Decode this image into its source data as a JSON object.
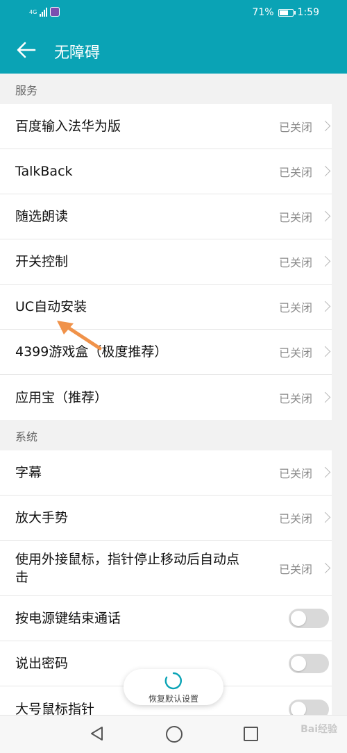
{
  "status_bar": {
    "network": "4G",
    "battery_percent": 71,
    "battery_text": "71%",
    "time": "1:59"
  },
  "app_bar": {
    "title": "无障碍",
    "back_icon": "arrow-left-icon"
  },
  "sections": [
    {
      "header": "服务",
      "items": [
        {
          "label": "百度输入法华为版",
          "value": "已关闭"
        },
        {
          "label": "TalkBack",
          "value": "已关闭"
        },
        {
          "label": "随选朗读",
          "value": "已关闭"
        },
        {
          "label": "开关控制",
          "value": "已关闭"
        },
        {
          "label": "UC自动安装",
          "value": "已关闭"
        },
        {
          "label": "4399游戏盒（极度推荐）",
          "value": "已关闭"
        },
        {
          "label": "应用宝（推荐）",
          "value": "已关闭"
        }
      ]
    },
    {
      "header": "系统",
      "items": [
        {
          "label": "字幕",
          "value": "已关闭"
        },
        {
          "label": "放大手势",
          "value": "已关闭"
        },
        {
          "label": "使用外接鼠标，指针停止移动后自动点击",
          "value": "已关闭"
        },
        {
          "label": "按电源键结束通话",
          "toggle": false
        },
        {
          "label": "说出密码",
          "toggle": false
        },
        {
          "label": "大号鼠标指针",
          "toggle": false
        }
      ]
    }
  ],
  "restore_button": {
    "label": "恢复默认设置"
  },
  "watermark": "Bai经验",
  "colors": {
    "accent": "#0aa3b5",
    "annotation_arrow": "#f0924a"
  }
}
